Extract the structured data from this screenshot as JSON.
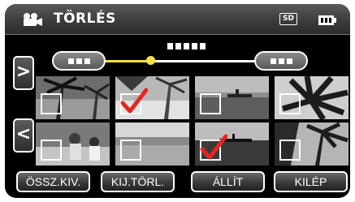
{
  "header": {
    "title": "TÖRLÉS",
    "mode_icon": "video-camera-icon",
    "media_badge": "SD",
    "battery_icon": "battery-icon"
  },
  "navigation": {
    "prev_group_icon": "left-pill-icon",
    "next_group_icon": "right-pill-icon",
    "date_icon": "date-placeholder-icon",
    "scrubber_position": 0.3
  },
  "paging": {
    "next_icon": "chevron-right-icon",
    "prev_icon": "chevron-left-icon",
    "next_glyph": ">",
    "prev_glyph": "<"
  },
  "thumbnails": [
    {
      "checked": false,
      "scene": "palm-trees"
    },
    {
      "checked": true,
      "scene": "beach-scene"
    },
    {
      "checked": false,
      "scene": "boat-on-water"
    },
    {
      "checked": false,
      "scene": "palm-leaves"
    },
    {
      "checked": false,
      "scene": "family-on-beach"
    },
    {
      "checked": false,
      "scene": "sea-horizon"
    },
    {
      "checked": true,
      "scene": "sunset-canoe"
    },
    {
      "checked": false,
      "scene": "palm-silhouette"
    }
  ],
  "buttons": {
    "select_all": "ÖSSZ.KIV.",
    "clear_selection": "KIJ.TÖRL.",
    "set": "ÁLLÍT",
    "exit": "KILÉP"
  },
  "colors": {
    "accent": "#f3e24a",
    "check_mark": "#e52620"
  }
}
